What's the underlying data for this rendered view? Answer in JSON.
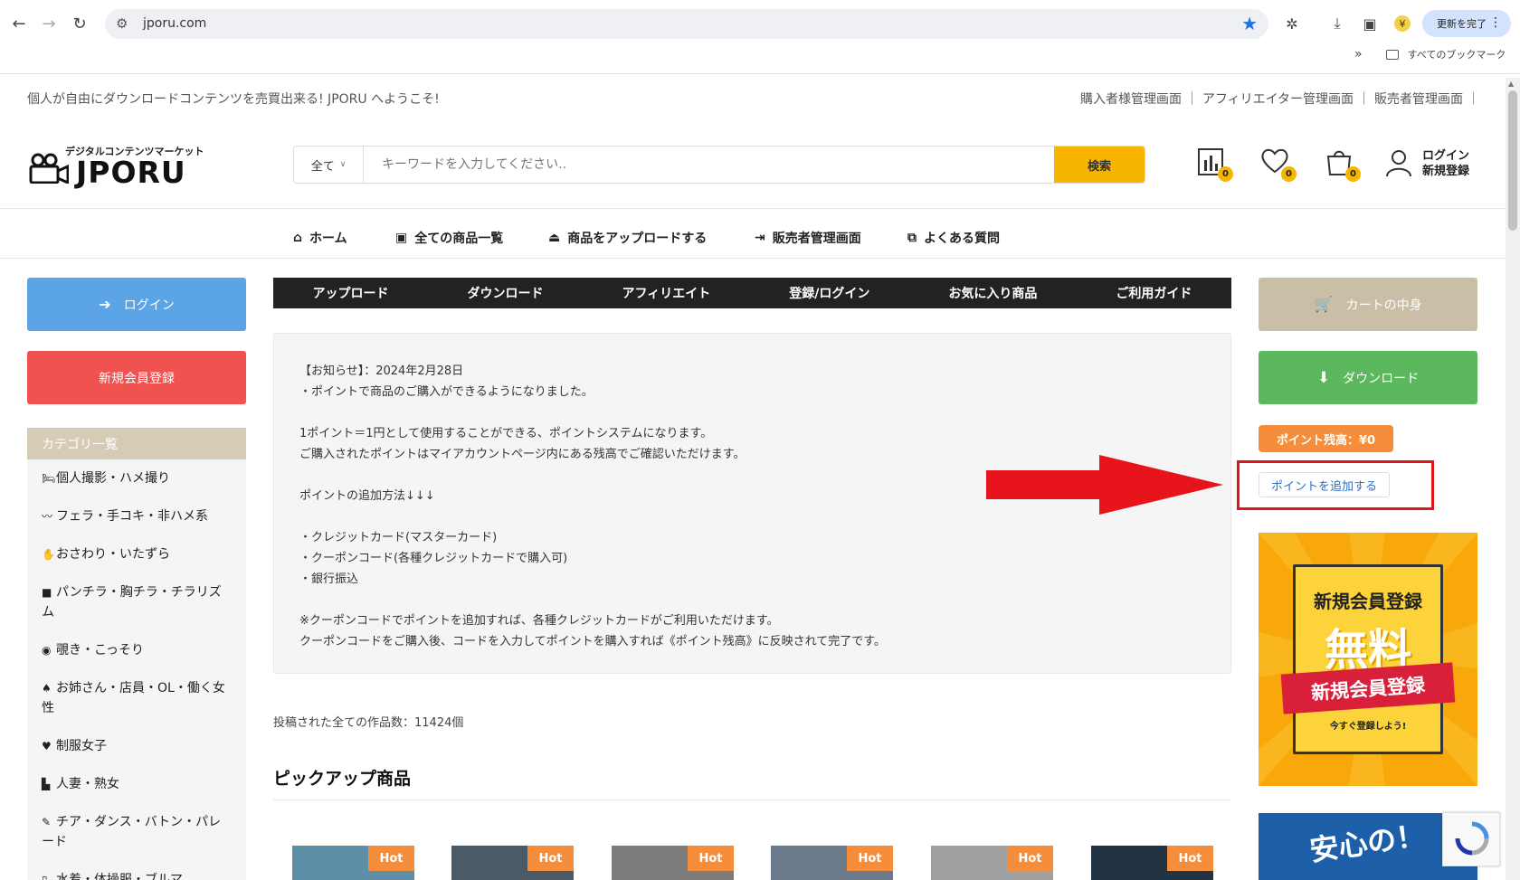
{
  "browser": {
    "url": "jporu.com",
    "update_label": "更新を完了",
    "bookmarks_label": "すべてのブックマーク",
    "chevron": "»"
  },
  "topbar": {
    "welcome": "個人が自由にダウンロードコンテンツを売買出来る! JPORU へようこそ!",
    "links": "購入者様管理画面 ｜ アフィリエイター管理画面 ｜ 販売者管理画面 ｜"
  },
  "logo": {
    "sub": "デジタルコンテンツマーケット",
    "main": "JPORU"
  },
  "search": {
    "category": "全て",
    "placeholder": "キーワードを入力してください..",
    "button": "検索"
  },
  "header_icons": {
    "compare_count": "0",
    "wishlist_count": "0",
    "cart_count": "0",
    "login": "ログイン",
    "register": "新規登録"
  },
  "nav": {
    "home": "ホーム",
    "all_products": "全ての商品一覧",
    "upload": "商品をアップロードする",
    "seller": "販売者管理画面",
    "faq": "よくある質問"
  },
  "sidebar": {
    "login_button": "ログイン",
    "register_button": "新規会員登録",
    "category_title": "カテゴリ一覧",
    "categories": [
      {
        "icon": "🛏",
        "label": "個人撮影・ハメ撮り"
      },
      {
        "icon": "〰",
        "label": "フェラ・手コキ・非ハメ系"
      },
      {
        "icon": "✋",
        "label": "おさわり・いたずら"
      },
      {
        "icon": "■",
        "label": "パンチラ・胸チラ・チラリズム"
      },
      {
        "icon": "◉",
        "label": "覗き・こっそり"
      },
      {
        "icon": "♠",
        "label": "お姉さん・店員・OL・働く女性"
      },
      {
        "icon": "♥",
        "label": "制服女子"
      },
      {
        "icon": "▙",
        "label": "人妻・熟女"
      },
      {
        "icon": "✎",
        "label": "チア・ダンス・バトン・パレード"
      },
      {
        "icon": "▯",
        "label": "水着・体操服・ブルマ"
      }
    ]
  },
  "tabs": [
    "アップロード",
    "ダウンロード",
    "アフィリエイト",
    "登録/ログイン",
    "お気に入り商品",
    "ご利用ガイド"
  ],
  "notice": {
    "lines": [
      "【お知らせ】：2024年2月28日",
      "・ポイントで商品のご購入ができるようになりました。",
      "",
      "1ポイント＝1円として使用することができる、ポイントシステムになります。",
      "ご購入されたポイントはマイアカウントページ内にある残高でご確認いただけます。",
      "",
      "ポイントの追加方法↓↓↓",
      "",
      "・クレジットカード(マスターカード)",
      "・クーポンコード(各種クレジットカードで購入可)",
      "・銀行振込",
      "",
      "※クーポンコードでポイントを追加すれば、各種クレジットカードがご利用いただけます。",
      "クーポンコードをご購入後、コードを入力してポイントを購入すれば《ポイント残高》に反映されて完了です。"
    ]
  },
  "count_text": "投稿された全ての作品数：11424個",
  "pickup_title": "ピックアップ商品",
  "hot_label": "Hot",
  "right": {
    "cart_button": "カートの中身",
    "download_button": "ダウンロード",
    "points_badge": "ポイント残高：¥0",
    "add_points": "ポイントを追加する",
    "promo_top": "新規会員登録",
    "promo_big": "無料",
    "promo_ribbon": "新規会員登録",
    "promo_small": "今すぐ登録しよう!",
    "promo2_text": "安心の！"
  },
  "colors": {
    "accent": "#f7b500",
    "login_blue": "#5ba4e6",
    "register_red": "#f0524f",
    "highlight_red": "#e0151c"
  }
}
